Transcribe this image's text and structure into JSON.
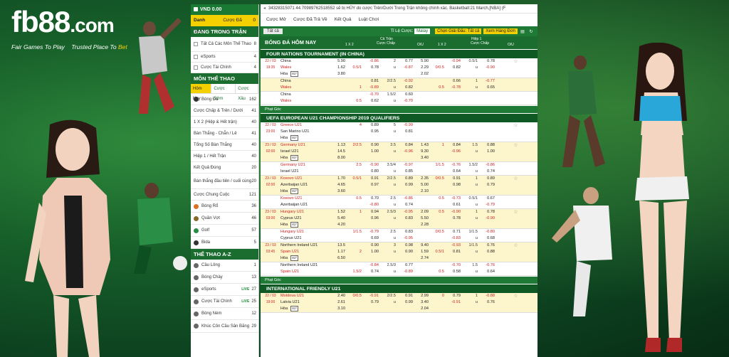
{
  "brand": {
    "logo": "fb88",
    "logo_suffix": ".com",
    "tagline1": "Fair Games To Play",
    "tagline2": "Trusted Place To",
    "tagline3": "Bet"
  },
  "sidebar": {
    "wallet": "VND 0.00",
    "tabs": [
      {
        "label": "Danh Sách"
      },
      {
        "label": "Cược Đã Đặt"
      }
    ],
    "bets_count": "0",
    "live_title": "ĐANG TRONG TRẬN",
    "live_items": [
      {
        "label": "Tất Cả Các Môn Thể Thao",
        "count": "8"
      },
      {
        "label": "eSports",
        "count": "4"
      },
      {
        "label": "Cược Tài Chính",
        "count": "4"
      }
    ],
    "sports_title": "MÔN THỂ THAO",
    "sport_tabs": [
      {
        "label": "Hôm Nay"
      },
      {
        "label": "Cược Sớm"
      },
      {
        "label": "Cược Xâu"
      }
    ],
    "sports": [
      {
        "label": "Bóng Đá",
        "count": "162"
      },
      {
        "label": "Cược Chấp & Trên / Dưới",
        "count": "41"
      },
      {
        "label": "1 X 2 (Hiệp & Hết trận)",
        "count": "40"
      },
      {
        "label": "Bàn Thắng - Chẵn / Lẻ",
        "count": "41"
      },
      {
        "label": "Tổng Số Bàn Thắng",
        "count": "40"
      },
      {
        "label": "Hiệp 1 / Hết Trận",
        "count": "40"
      },
      {
        "label": "Kết Quả Đúng",
        "count": "20"
      },
      {
        "label": "Bàn thắng đầu tiên / cuối cùng",
        "count": "20"
      },
      {
        "label": "Cược Chung Cuộc",
        "count": "121"
      },
      {
        "label": "Bóng Rổ",
        "count": "36"
      },
      {
        "label": "Quần Vợt",
        "count": "46"
      },
      {
        "label": "Golf",
        "count": "57"
      },
      {
        "label": "Bida",
        "count": "5"
      }
    ],
    "az_title": "THỂ THAO A-Z",
    "az": [
      {
        "label": "Cầu Lông",
        "count": "1",
        "live": ""
      },
      {
        "label": "Bóng Chày",
        "count": "13",
        "live": ""
      },
      {
        "label": "eSports",
        "count": "27",
        "live": "LIVE"
      },
      {
        "label": "Cược Tài Chính",
        "count": "25",
        "live": "LIVE"
      },
      {
        "label": "Bóng Ném",
        "count": "12",
        "live": ""
      },
      {
        "label": "Khúc Côn Cầu Sân Băng",
        "count": "29",
        "live": ""
      }
    ]
  },
  "main": {
    "ticker": "34328315071 44.70989762518552 sẽ bị HỦY do cược Trên/Dưới Trong Trận không chính xác. Basketball:21 March,[NBA] (F",
    "tabs": [
      {
        "label": "Cược Mở"
      },
      {
        "label": "Cược Đã Trả Về"
      },
      {
        "label": "Kết Quả"
      },
      {
        "label": "Luật Chơi"
      }
    ],
    "filter": {
      "all": "Tất cả",
      "ratio_label": "Tỉ Lệ Cược:",
      "ratio_value": "Malay",
      "btn1": "Chọn Giải Đấu: Tất cả",
      "btn2": "Xem Hàng Đơn"
    },
    "header": {
      "title": "BÓNG ĐÁ HÔM NAY",
      "ft": "Cả Trận",
      "h1": "Hiệp 1",
      "onex2": "1 X 2",
      "hdp": "Cược Chấp",
      "ou": "O/U"
    },
    "sections": [
      {
        "league": "FOUR NATIONS TOURNAMENT (IN CHINA)",
        "corner": "Phạt Góc",
        "groups": [
          {
            "y": false,
            "date": "22 / 03",
            "time": "19:35",
            "home": "China",
            "away": "Wales",
            "draw": "Hòa",
            "ox": [
              "5.90",
              "1.62",
              "3.80"
            ],
            "hdp": [
              "",
              "0.5/1"
            ],
            "hodd": [
              "-0.86",
              "0.78"
            ],
            "ou": [
              "2",
              "u"
            ],
            "oodd": [
              "0.77",
              "-0.87"
            ],
            "h1x2": [
              "5.90",
              "2.29",
              "2.02"
            ],
            "h1hdp": [
              "",
              "0/0.5"
            ],
            "h1hodd": [
              "-0.94",
              "0.82"
            ],
            "h1ou": [
              "0.5/1",
              "u"
            ],
            "h1oodd": [
              "0.78",
              "-0.90"
            ],
            "tv": true
          },
          {
            "y": true,
            "home": "China",
            "away": "Wales",
            "ox": [
              "",
              ""
            ],
            "hdp": [
              "",
              "1"
            ],
            "hodd": [
              "0.81",
              "-0.89"
            ],
            "ou": [
              "2/2.5",
              "u"
            ],
            "oodd": [
              "-0.92",
              "0.82"
            ],
            "h1x2": [
              "",
              ""
            ],
            "h1hdp": [
              "",
              "0.5"
            ],
            "h1hodd": [
              "0.66",
              "-0.78"
            ],
            "h1ou": [
              "1",
              "u"
            ],
            "h1oodd": [
              "-0.77",
              "0.65"
            ]
          },
          {
            "y": false,
            "home": "China",
            "away": "Wales",
            "ox": [
              "",
              ""
            ],
            "hdp": [
              "",
              "0.5"
            ],
            "hodd": [
              "-0.70",
              "0.62"
            ],
            "ou": [
              "1.5/2",
              "u"
            ],
            "oodd": [
              "0.60",
              "-0.70"
            ],
            "h1x2": [
              "",
              ""
            ],
            "h1hdp": [
              "",
              ""
            ],
            "h1hodd": [
              "",
              ""
            ],
            "h1ou": [
              "",
              ""
            ],
            "h1oodd": [
              "",
              ""
            ]
          }
        ]
      },
      {
        "league": "UEFA EUROPEAN U21 CHAMPIONSHIP 2019 QUALIFIERS",
        "corner": "Phạt Góc",
        "groups": [
          {
            "y": false,
            "date": "22 / 03",
            "time": "23:00",
            "home": "Greece U21",
            "away": "San Marino U21",
            "draw": "Hòa",
            "ox": [
              "",
              "",
              ""
            ],
            "hdp": [
              "4",
              ""
            ],
            "hodd": [
              "0.89",
              "0.95"
            ],
            "ou": [
              "5",
              "u"
            ],
            "oodd": [
              "-0.99",
              "0.81"
            ],
            "h1x2": [
              "",
              "",
              ""
            ],
            "h1hdp": [
              "",
              ""
            ],
            "h1hodd": [
              "",
              ""
            ],
            "h1ou": [
              "",
              ""
            ],
            "h1oodd": [
              "",
              ""
            ],
            "tv": true
          },
          {
            "y": true,
            "date": "23 / 03",
            "time": "02:00",
            "home": "Germany U21",
            "away": "Israel U21",
            "draw": "Hòa",
            "ox": [
              "1.13",
              "14.5",
              "8.00"
            ],
            "hdp": [
              "2/2.5",
              ""
            ],
            "hodd": [
              "0.90",
              "1.00"
            ],
            "ou": [
              "3.5",
              "u"
            ],
            "oodd": [
              "0.84",
              "-0.96"
            ],
            "h1x2": [
              "1.43",
              "9.30",
              "3.40"
            ],
            "h1hdp": [
              "1",
              ""
            ],
            "h1hodd": [
              "0.84",
              "-0.96"
            ],
            "h1ou": [
              "1.5",
              "u"
            ],
            "h1oodd": [
              "0.88",
              "1.00"
            ],
            "tv": true
          },
          {
            "y": false,
            "home": "Germany U21",
            "away": "Israel U21",
            "ox": [
              "",
              ""
            ],
            "hdp": [
              "2.5",
              ""
            ],
            "hodd": [
              "-0.90",
              "0.80"
            ],
            "ou": [
              "3.5/4",
              "u"
            ],
            "oodd": [
              "-0.97",
              "0.85"
            ],
            "h1x2": [
              "",
              ""
            ],
            "h1hdp": [
              "1/1.5",
              ""
            ],
            "h1hodd": [
              "-0.76",
              "0.64"
            ],
            "h1ou": [
              "1.5/2",
              "u"
            ],
            "h1oodd": [
              "-0.86",
              "0.74"
            ]
          },
          {
            "y": true,
            "date": "23 / 03",
            "time": "02:00",
            "home": "Kosovo U21",
            "away": "Azerbaijan U21",
            "draw": "Hòa",
            "ox": [
              "1.70",
              "4.65",
              "3.60"
            ],
            "hdp": [
              "0.5/1",
              ""
            ],
            "hodd": [
              "0.91",
              "0.97"
            ],
            "ou": [
              "2/2.5",
              "u"
            ],
            "oodd": [
              "0.89",
              "0.99"
            ],
            "h1x2": [
              "2.35",
              "5.00",
              "2.10"
            ],
            "h1hdp": [
              "0/0.5",
              ""
            ],
            "h1hodd": [
              "0.91",
              "0.98"
            ],
            "h1ou": [
              "1",
              "u"
            ],
            "h1oodd": [
              "0.89",
              "0.79"
            ],
            "tv": true
          },
          {
            "y": false,
            "home": "Kosovo U21",
            "away": "Azerbaijan U21",
            "ox": [
              "",
              ""
            ],
            "hdp": [
              "0.5",
              ""
            ],
            "hodd": [
              "0.70",
              "-0.80"
            ],
            "ou": [
              "2.5",
              "u"
            ],
            "oodd": [
              "-0.86",
              "0.74"
            ],
            "h1x2": [
              "",
              ""
            ],
            "h1hdp": [
              "0.5",
              ""
            ],
            "h1hodd": [
              "-0.73",
              "0.61"
            ],
            "h1ou": [
              "0.5/1",
              "u"
            ],
            "h1oodd": [
              "0.67",
              "-0.79"
            ]
          },
          {
            "y": true,
            "date": "23 / 03",
            "time": "03:00",
            "home": "Hungary U21",
            "away": "Cyprus U21",
            "draw": "Hòa",
            "ox": [
              "1.52",
              "5.40",
              "4.20"
            ],
            "hdp": [
              "1",
              ""
            ],
            "hodd": [
              "0.94",
              "0.96"
            ],
            "ou": [
              "2.5/3",
              "u"
            ],
            "oodd": [
              "-0.95",
              "0.83"
            ],
            "h1x2": [
              "2.09",
              "5.50",
              "2.28"
            ],
            "h1hdp": [
              "0.5",
              ""
            ],
            "h1hodd": [
              "-0.90",
              "0.78"
            ],
            "h1ou": [
              "1",
              "u"
            ],
            "h1oodd": [
              "0.78",
              "-0.90"
            ],
            "tv": true
          },
          {
            "y": false,
            "home": "Hungary U21",
            "away": "Cyprus U21",
            "ox": [
              "",
              ""
            ],
            "hdp": [
              "1/1.5",
              ""
            ],
            "hodd": [
              "-0.79",
              "0.69"
            ],
            "ou": [
              "2.5",
              "u"
            ],
            "oodd": [
              "0.83",
              "-0.95"
            ],
            "h1x2": [
              "",
              ""
            ],
            "h1hdp": [
              "0/0.5",
              ""
            ],
            "h1hodd": [
              "0.71",
              "-0.83"
            ],
            "h1ou": [
              "1/1.5",
              "u"
            ],
            "h1oodd": [
              "-0.80",
              "0.68"
            ]
          },
          {
            "y": true,
            "date": "23 / 03",
            "time": "03:45",
            "home": "Northern Ireland U21",
            "away": "Spain U21",
            "draw": "Hòa",
            "ox": [
              "13.5",
              "1.17",
              "6.50"
            ],
            "hdp": [
              "",
              "2"
            ],
            "hodd": [
              "0.90",
              "1.00"
            ],
            "ou": [
              "3",
              "u"
            ],
            "oodd": [
              "0.98",
              "0.90"
            ],
            "h1x2": [
              "9.40",
              "1.59",
              "2.74"
            ],
            "h1hdp": [
              "",
              "0.5/1"
            ],
            "h1hodd": [
              "-0.93",
              "0.81"
            ],
            "h1ou": [
              "1/1.5",
              "u"
            ],
            "h1oodd": [
              "0.76",
              "0.88"
            ],
            "tv": true
          },
          {
            "y": false,
            "home": "Northern Ireland U21",
            "away": "Spain U21",
            "ox": [
              "",
              ""
            ],
            "hdp": [
              "",
              "1.5/2"
            ],
            "hodd": [
              "-0.84",
              "0.74"
            ],
            "ou": [
              "2.5/3",
              "u"
            ],
            "oodd": [
              "0.77",
              "-0.89"
            ],
            "h1x2": [
              "",
              ""
            ],
            "h1hdp": [
              "",
              "0.5"
            ],
            "h1hodd": [
              "-0.70",
              "0.58"
            ],
            "h1ou": [
              "1.5",
              "u"
            ],
            "h1oodd": [
              "-0.76",
              "0.64"
            ]
          }
        ]
      },
      {
        "league": "INTERNATIONAL FRIENDLY U21",
        "corner": "Phạt Góc",
        "groups": [
          {
            "y": true,
            "date": "22 / 03",
            "time": "19:00",
            "home": "Moldova U21",
            "away": "Latvia U21",
            "draw": "Hòa",
            "ox": [
              "2.40",
              "2.61",
              "3.10"
            ],
            "hdp": [
              "0/0.5",
              ""
            ],
            "hodd": [
              "-0.91",
              "0.79"
            ],
            "ou": [
              "2/2.5",
              "u"
            ],
            "oodd": [
              "0.91",
              "0.99"
            ],
            "h1x2": [
              "2.99",
              "3.40",
              "2.04"
            ],
            "h1hdp": [
              "0",
              ""
            ],
            "h1hodd": [
              "0.79",
              "-0.91"
            ],
            "h1ou": [
              "1",
              "u"
            ],
            "h1oodd": [
              "-0.88",
              "0.76"
            ],
            "tv": true
          }
        ]
      }
    ]
  },
  "colors": {
    "green": "#1a6d2f",
    "yellow": "#f5d000",
    "red": "#cc2222"
  }
}
